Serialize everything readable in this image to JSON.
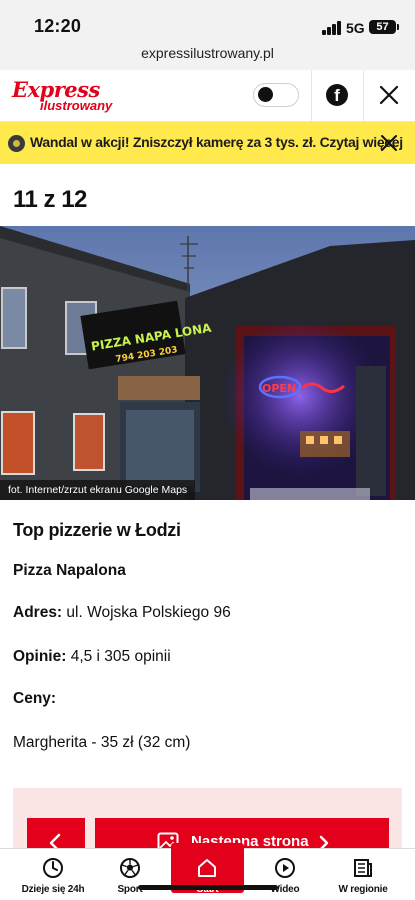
{
  "status_bar": {
    "time": "12:20",
    "network": "5G",
    "battery": "57"
  },
  "browser": {
    "url": "expressilustrowany.pl"
  },
  "header": {
    "logo_top": "Express",
    "logo_bottom": "ilustrowany",
    "brand_color": "#e2001a"
  },
  "banner": {
    "text": "Wandal w akcji! Zniszczył kamerę za 3 tys. zł. Czytaj więcej",
    "background": "#ffe94d"
  },
  "article": {
    "counter": "11 z 12",
    "photo_sign_line1": "PIZZA NAPA LONA",
    "photo_sign_phone": "794 203 203",
    "photo_open_sign": "OPEN",
    "photo_caption": "fot. Internet/zrzut ekranu Google Maps",
    "title": "Top pizzerie w Łodzi",
    "name": "Pizza Napalona",
    "address_label": "Adres:",
    "address_value": "ul. Wojska Polskiego 96",
    "reviews_label": "Opinie:",
    "reviews_value": "4,5 i 305 opinii",
    "prices_label": "Ceny:",
    "price_line": "Margherita - 35 zł (32 cm)"
  },
  "pager": {
    "next_label": "Następna strona"
  },
  "bottom_nav": [
    {
      "label": "Dzieje się 24h",
      "icon": "clock-icon"
    },
    {
      "label": "Sport",
      "icon": "football-icon"
    },
    {
      "label": "Start",
      "icon": "home-icon",
      "active": true
    },
    {
      "label": "Wideo",
      "icon": "play-icon"
    },
    {
      "label": "W regionie",
      "icon": "news-icon"
    }
  ]
}
